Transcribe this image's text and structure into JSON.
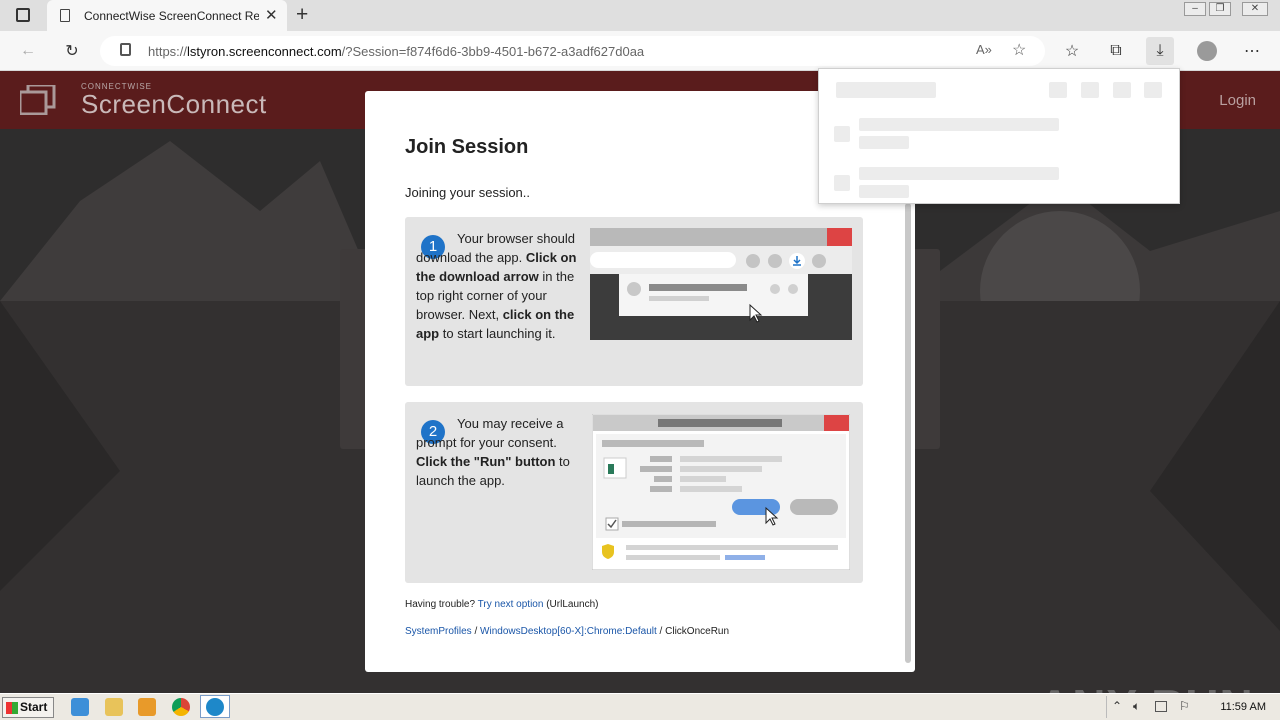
{
  "browser": {
    "tab_title": "ConnectWise ScreenConnect Remote Support",
    "url_prefix": "https://",
    "url_host": "lstyron.screenconnect.com",
    "url_rest": "/?Session=f874f6d6-3bb9-4501-b672-a3adf627d0aa"
  },
  "site": {
    "brand_small": "CONNECTWISE",
    "brand": "ScreenConnect",
    "login_label": "Login"
  },
  "modal": {
    "title": "Join Session",
    "status": "Joining your session..",
    "step1": {
      "number": "1",
      "t1": "Your browser should download the app. ",
      "b1": "Click on the download arrow",
      "t2": " in the top right corner of your browser. Next, ",
      "b2": "click on the app",
      "t3": " to start launching it."
    },
    "step2": {
      "number": "2",
      "t1": "You may receive a prompt for your consent. ",
      "b1": "Click the \"Run\" button",
      "t2": " to launch the app."
    },
    "trouble_label": "Having trouble?",
    "trouble_link": "Try next option",
    "trouble_suffix": "(UrlLaunch)",
    "crumb1": "SystemProfiles",
    "crumb_sep": " / ",
    "crumb2": "WindowsDesktop[60-X]:Chrome:Default",
    "crumb3": "ClickOnceRun"
  },
  "taskbar": {
    "start_label": "Start",
    "clock": "11:59 AM"
  },
  "watermark": "ANY RUN",
  "colors": {
    "header_bg": "#5a1c1c",
    "step_badge": "#1f73c8",
    "link": "#1a56a8"
  }
}
